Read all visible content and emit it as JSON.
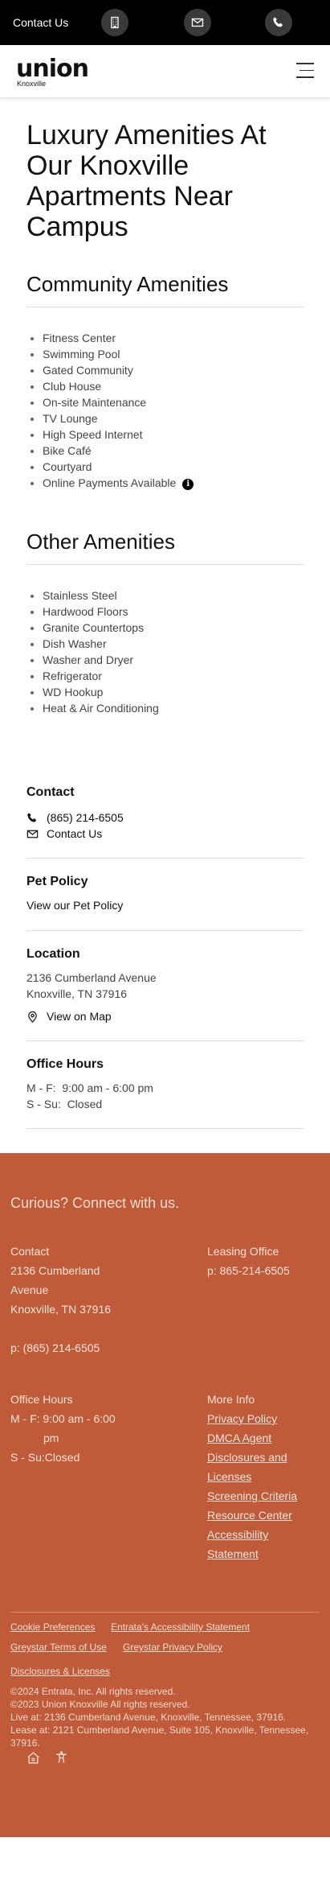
{
  "topbar": {
    "contact_label": "Contact Us",
    "icons": [
      "building-icon",
      "envelope-icon",
      "phone-icon"
    ]
  },
  "header": {
    "logo_text": "union",
    "logo_sub": "Knoxville",
    "menu_icon": "hamburger-menu-icon"
  },
  "main": {
    "title": "Luxury Amenities At Our Knoxville Apartments Near Campus",
    "community": {
      "heading": "Community Amenities",
      "items": [
        "Fitness Center",
        "Swimming Pool",
        "Gated Community",
        "Club House",
        "On-site Maintenance",
        "TV Lounge",
        "High Speed Internet",
        "Bike Café",
        "Courtyard",
        "Online Payments Available"
      ]
    },
    "other": {
      "heading": "Other Amenities",
      "items": [
        "Stainless Steel",
        "Hardwood Floors",
        "Granite Countertops",
        "Dish Washer",
        "Washer and Dryer",
        "Refrigerator",
        "WD Hookup",
        "Heat & Air Conditioning"
      ]
    }
  },
  "sidebar": {
    "contact": {
      "heading": "Contact",
      "phone": "(865) 214-6505",
      "contact_us": "Contact Us"
    },
    "pet": {
      "heading": "Pet Policy",
      "link": "View our Pet Policy"
    },
    "location": {
      "heading": "Location",
      "line1": "2136 Cumberland Avenue",
      "line2": "Knoxville, TN 37916",
      "map_link": "View on Map"
    },
    "hours": {
      "heading": "Office Hours",
      "weekday": "M - F:  9:00 am - 6:00 pm",
      "weekend": "S - Su:  Closed"
    }
  },
  "footer": {
    "tagline": "Curious? Connect with us.",
    "contact": {
      "heading": "Contact",
      "address1": "2136 Cumberland",
      "address2": "Avenue",
      "address3": "Knoxville, TN 37916",
      "phone": "p: (865) 214-6505"
    },
    "leasing": {
      "heading": "Leasing Office",
      "phone": "p: 865-214-6505"
    },
    "hours": {
      "heading": "Office Hours",
      "weekday1": "M - F: 9:00 am - 6:00",
      "weekday2": "pm",
      "weekend": "S - Su:Closed"
    },
    "more_info": {
      "heading": "More Info",
      "links": [
        "Privacy Policy",
        "DMCA Agent",
        "Disclosures and",
        "Licenses",
        "Screening Criteria",
        "Resource Center",
        "Accessibility",
        "Statement"
      ]
    },
    "bottom_links": [
      "Cookie Preferences",
      "Entrata's Accessibility Statement",
      "Greystar Terms of Use",
      "Greystar Privacy Policy",
      "Disclosures & Licenses"
    ],
    "legal": [
      "©2024 Entrata, Inc. All rights reserved.",
      "©2023 Union Knoxville All rights reserved.",
      "Live at: 2136 Cumberland Avenue, Knoxville, Tennessee, 37916.",
      "Lease at: 2121 Cumberland Avenue, Suite 105, Knoxville, Tennessee, 37916."
    ],
    "icons": [
      "equal-housing-icon",
      "accessibility-icon"
    ]
  }
}
